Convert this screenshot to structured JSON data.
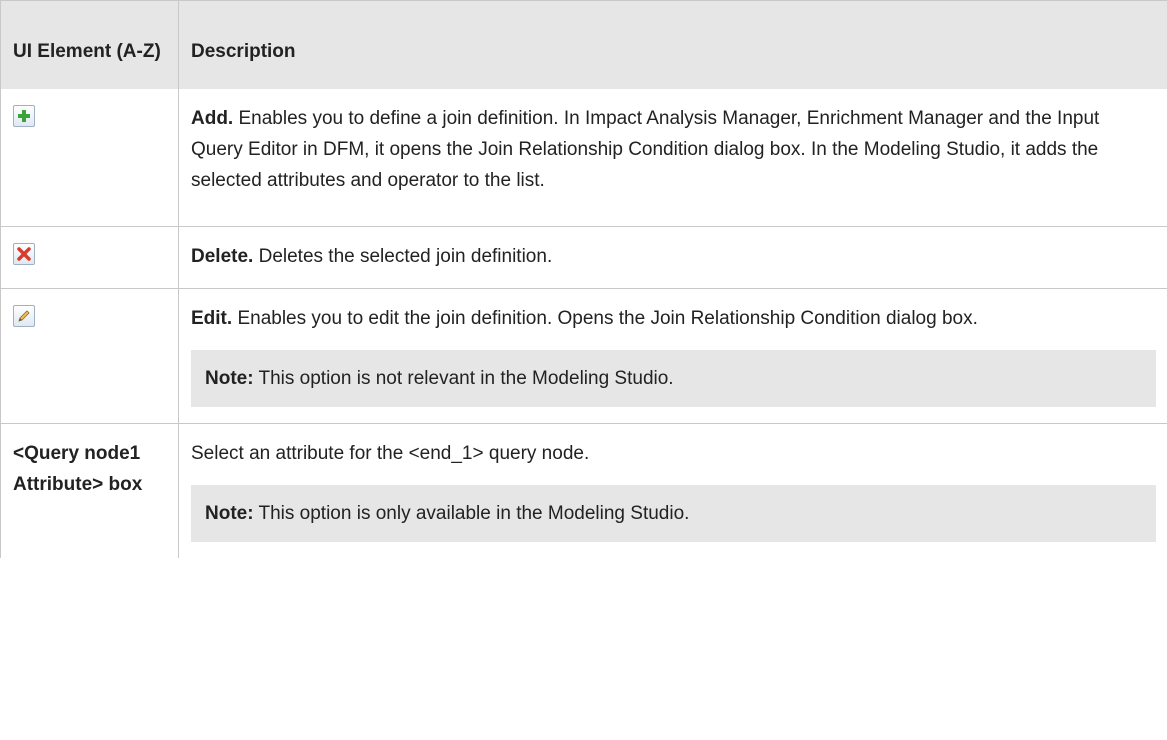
{
  "header": {
    "col1": "UI Element (A-Z)",
    "col2": "Description"
  },
  "rows": [
    {
      "icon": "add-icon",
      "term": "Add.",
      "text": " Enables you to define a join definition. In Impact Analysis Manager, Enrichment Manager and the Input Query Editor in DFM, it opens the Join Relationship Condition dialog box. In the Modeling Studio, it adds the selected attributes and operator to the list."
    },
    {
      "icon": "delete-icon",
      "term": "Delete.",
      "text": " Deletes the selected join definition."
    },
    {
      "icon": "edit-icon",
      "term": "Edit.",
      "text": " Enables you to edit the join definition. Opens the Join Relationship Condition dialog box.",
      "note_label": "Note:",
      "note_text": " This option is not relevant in the Modeling Studio."
    },
    {
      "element": "<Query node1 Attribute> box",
      "text": "Select an attribute for the <end_1> query node.",
      "note_label": "Note:",
      "note_text": " This option is only available in the Modeling Studio."
    }
  ],
  "colors": {
    "header_bg": "#e6e6e6",
    "note_bg": "#e6e6e6",
    "border": "#c8c8c8",
    "add_green": "#3aa33a",
    "delete_red": "#d93a2b"
  }
}
